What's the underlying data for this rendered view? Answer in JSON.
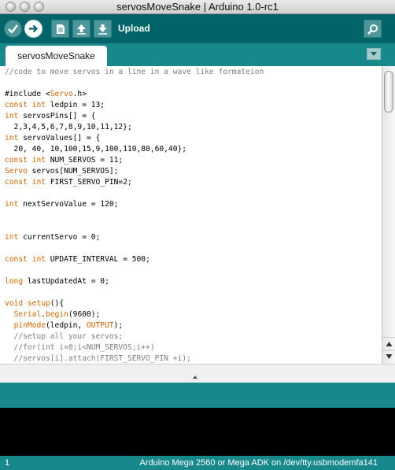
{
  "window": {
    "title": "servosMoveSnake | Arduino 1.0-rc1"
  },
  "toolbar": {
    "hover_label": "Upload"
  },
  "tabs": [
    {
      "label": "servosMoveSnake"
    }
  ],
  "editor": {
    "lines": [
      "//code to move servos in a line in a wave like formateion",
      "",
      "#include <Servo.h>",
      "const int ledpin = 13;",
      "int servosPins[] = {",
      "  2,3,4,5,6,7,8,9,10,11,12};",
      "int servoValues[] = {",
      "  20, 40, 10,100,15,9,100,110,80,60,40};",
      "const int NUM_SERVOS = 11;",
      "Servo servos[NUM_SERVOS];",
      "const int FIRST_SERVO_PIN=2;",
      "",
      "int nextServoValue = 120;",
      "",
      "",
      "int currentServo = 0;",
      "",
      "const int UPDATE_INTERVAL = 500;",
      "",
      "long lastUpdatedAt = 0;",
      "",
      "void setup(){",
      "  Serial.begin(9600);",
      "  pinMode(ledpin, OUTPUT);",
      "  //setup all your servos;",
      "  //for(int i=0;i<NUM_SERVOS;i++)",
      "  //servos[i].attach(FIRST_SERVO_PIN +i);"
    ]
  },
  "status": {
    "line_number": "1",
    "board": "Arduino Mega 2560 or Mega ADK on /dev/tty.usbmodemfa141"
  },
  "colors": {
    "toolbar": "#006468",
    "tabbar": "#17898d",
    "keyword": "#cc6600",
    "comment": "#7e7e7e"
  }
}
